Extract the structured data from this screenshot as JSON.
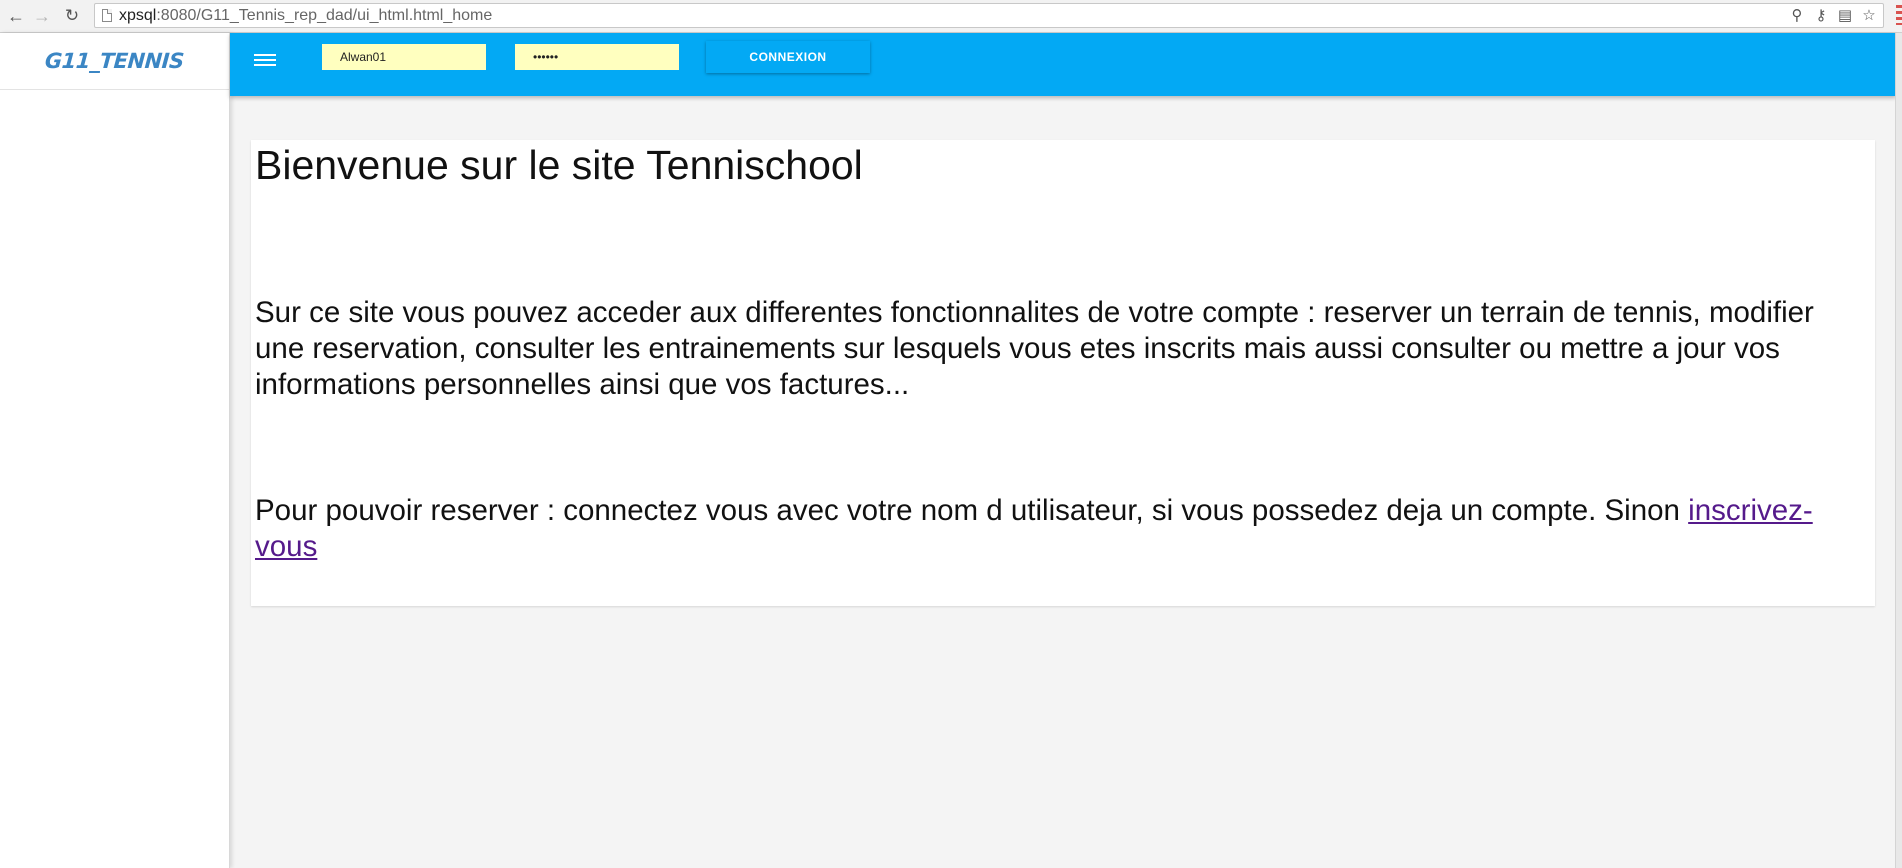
{
  "browser": {
    "url_host": "xpsql",
    "url_rest": ":8080/G11_Tennis_rep_dad/ui_html.html_home",
    "back_icon": "arrow-left-icon",
    "forward_icon": "arrow-right-icon",
    "reload_icon": "reload-icon"
  },
  "sidebar": {
    "brand": "G11_TENNIS"
  },
  "appbar": {
    "username_value": "Alwan01",
    "password_value": "••••••",
    "connexion_label": "CONNEXION",
    "accent_color": "#03a9f4",
    "input_bg_color": "#ffffbf"
  },
  "main": {
    "title": "Bienvenue sur le site Tennischool",
    "intro": "Sur ce site vous pouvez acceder aux differentes fonctionnalites de votre compte : reserver un terrain de tennis, modifier une reservation, consulter les entrainements sur lesquels vous etes inscrits mais aussi consulter ou mettre a jour vos informations personnelles ainsi que vos factures...",
    "reserve_text": "Pour pouvoir reserver : connectez vous avec votre nom d utilisateur, si vous possedez deja un compte. Sinon ",
    "signup_link": "inscrivez-vous"
  }
}
